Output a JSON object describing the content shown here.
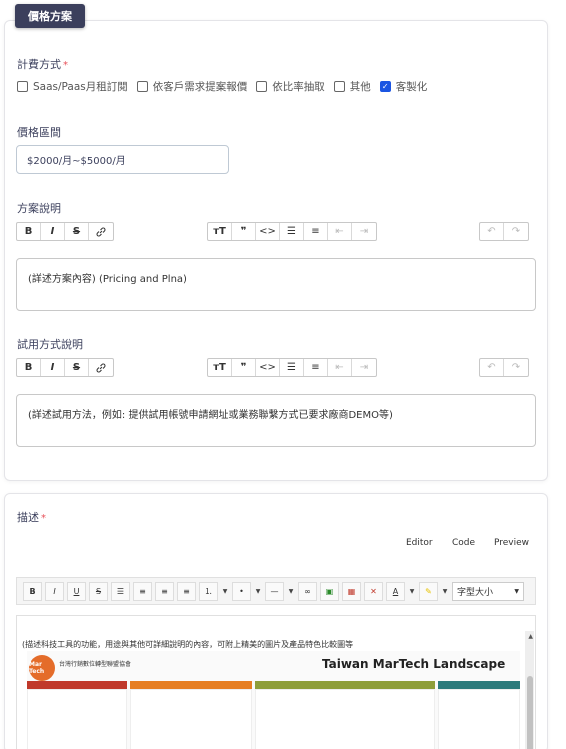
{
  "section_tab": "價格方案",
  "billing": {
    "label": "計費方式",
    "required_mark": "*",
    "options": [
      {
        "label": "Saas/Paas月租訂閱",
        "checked": false
      },
      {
        "label": "依客戶需求提案報價",
        "checked": false
      },
      {
        "label": "依比率抽取",
        "checked": false
      },
      {
        "label": "其他",
        "checked": false
      },
      {
        "label": "客製化",
        "checked": true
      }
    ]
  },
  "price_range": {
    "label": "價格區間",
    "value": "$2000/月~$5000/月"
  },
  "plan_desc": {
    "label": "方案說明",
    "content": "(詳述方案內容) (Pricing and Plna)"
  },
  "trial_desc": {
    "label": "試用方式說明",
    "content": "(詳述試用方法，例如: 提供試用帳號申請網址或業務聯繫方式已要求廠商DEMO等)"
  },
  "description": {
    "label": "描述",
    "required_mark": "*",
    "tabs": [
      "Editor",
      "Code",
      "Preview"
    ],
    "font_size_select": "字型大小",
    "content_text": "(描述科技工具的功能，用途與其他可詳細說明的內容，可附上精美的圖片及產品特色比較圖等",
    "image": {
      "logo_text": "Mar Tech",
      "org": "台灣行銷數位轉型聯盟協會",
      "title": "Taiwan MarTech Landscape"
    }
  },
  "colors": {
    "tab_bg": "#3b3f5c",
    "accent": "#1b55e2",
    "required": "#e7515a"
  }
}
